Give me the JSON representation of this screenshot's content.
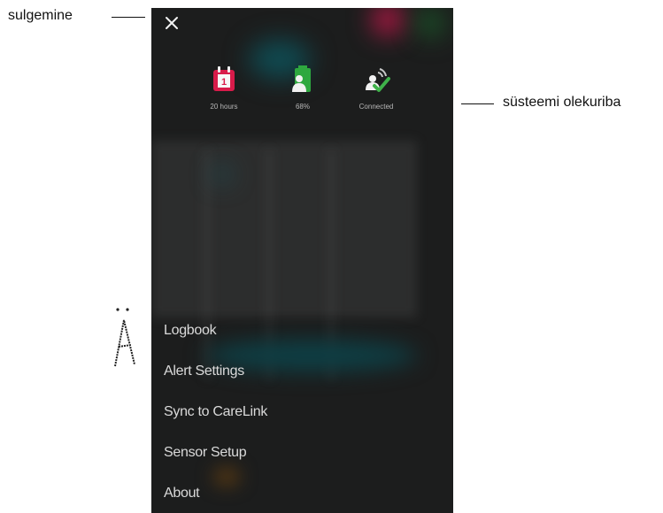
{
  "callouts": {
    "close_label": "sulgemine",
    "status_label": "süsteemi olekuriba"
  },
  "status_bar": {
    "calendar_badge": "1",
    "sensor_label": "20 hours",
    "battery_label": "68%",
    "connection_label": "Connected",
    "battery_level": 0.68
  },
  "menu": {
    "items": [
      {
        "label": "Logbook"
      },
      {
        "label": "Alert Settings"
      },
      {
        "label": "Sync to CareLink"
      },
      {
        "label": "Sensor Setup"
      },
      {
        "label": "About"
      }
    ]
  },
  "colors": {
    "panel": "#1c1d1d",
    "calendar": "#d81b4a",
    "battery": "#2ea83f",
    "check": "#3fb24a",
    "menu_text": "#dadada",
    "status_text": "#b8b8b8"
  },
  "icons": [
    "close-icon",
    "calendar-icon",
    "battery-icon",
    "connected-icon"
  ]
}
